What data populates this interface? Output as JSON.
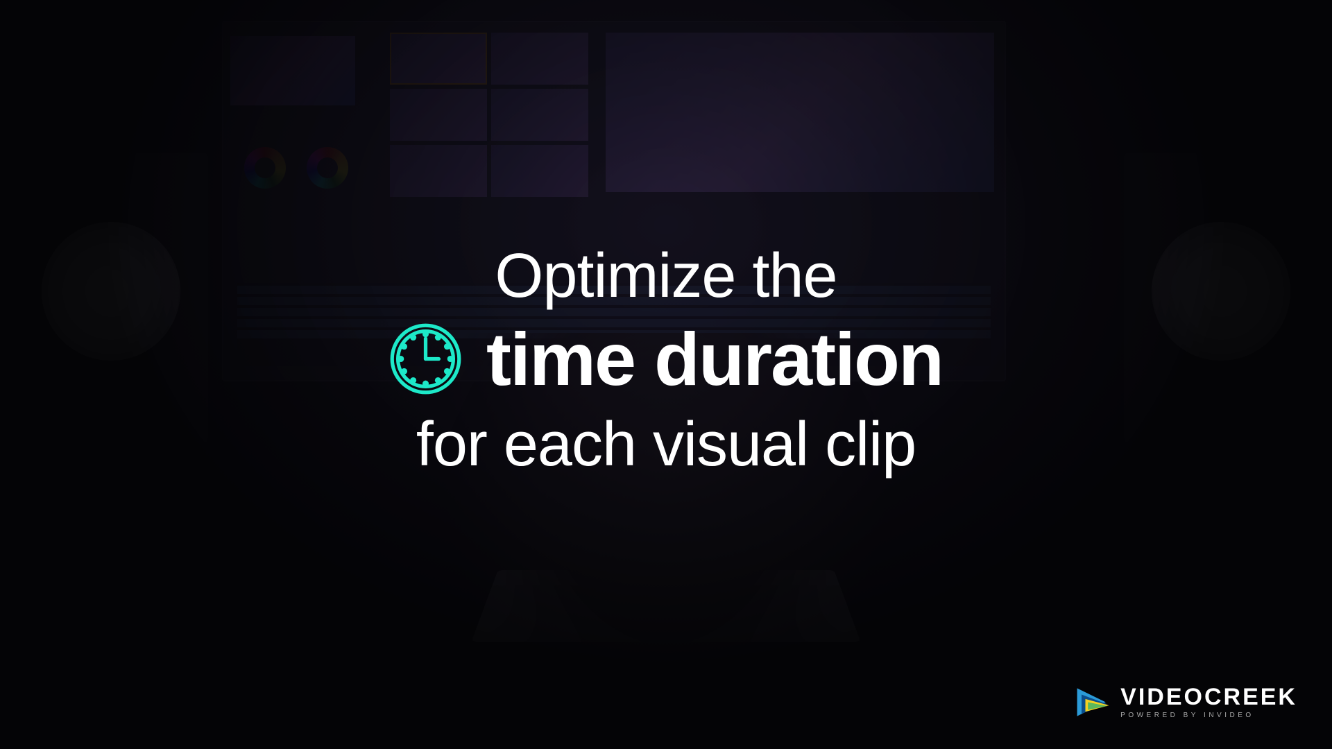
{
  "headline": {
    "line1": "Optimize the",
    "line2_bold": "time duration",
    "line3": "for each visual clip"
  },
  "icon": {
    "name": "clock-icon",
    "color": "#1de9c9"
  },
  "logo": {
    "brand": "VIDEOCREEK",
    "tagline": "POWERED BY INVIDEO"
  },
  "colors": {
    "accent": "#1de9c9",
    "text": "#ffffff",
    "background": "#0a0a0a"
  }
}
